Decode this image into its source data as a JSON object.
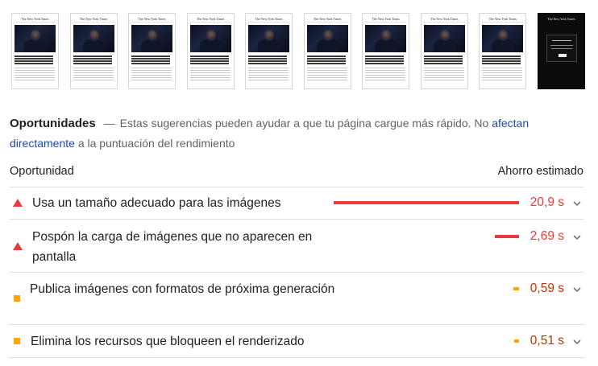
{
  "filmstrip": {
    "masthead": "The New York Times",
    "frames": [
      "article",
      "article",
      "article",
      "article",
      "article",
      "article",
      "article",
      "article",
      "article",
      "modal"
    ]
  },
  "section": {
    "title": "Oportunidades",
    "dash": "—",
    "description": "Estas sugerencias pueden ayudar a que tu página cargue más rápido. No ",
    "link_text": "afectan directamente",
    "description_end": " a la puntuación del rendimiento"
  },
  "table": {
    "col_opportunity": "Oportunidad",
    "col_savings": "Ahorro estimado"
  },
  "opportunities": [
    {
      "label": "Usa un tamaño adecuado para las imágenes",
      "savings": "20,9 s",
      "bar_fraction": 1.0,
      "severity": "fail"
    },
    {
      "label": "Pospón la carga de imágenes que no aparecen en pantalla",
      "savings": "2,69 s",
      "bar_fraction": 0.13,
      "severity": "fail"
    },
    {
      "label": "Publica imágenes con formatos de próxima generación",
      "savings": "0,59 s",
      "bar_fraction": 0.03,
      "severity": "average"
    },
    {
      "label": "Elimina los recursos que bloqueen el renderizado",
      "savings": "0,51 s",
      "bar_fraction": 0.025,
      "severity": "average"
    }
  ],
  "colors": {
    "fail": "#eb3a3a",
    "average": "#ffa400",
    "average_text": "#c33300",
    "link": "#1a4ba8"
  },
  "icons": {
    "fail": "triangle-icon",
    "average": "square-icon",
    "expand": "chevron-down-icon"
  }
}
